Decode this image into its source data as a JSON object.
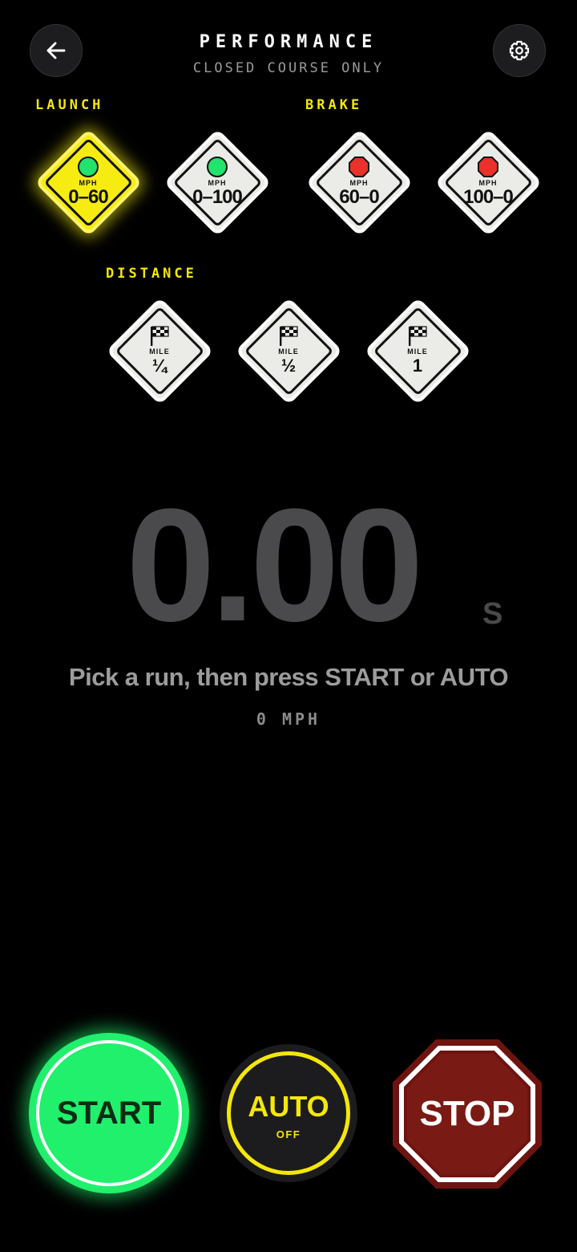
{
  "header": {
    "title": "PERFORMANCE",
    "subtitle": "CLOSED COURSE ONLY"
  },
  "sections": {
    "launch": "LAUNCH",
    "brake": "BRAKE",
    "distance": "DISTANCE"
  },
  "runs": [
    {
      "unit": "MPH",
      "value": "0–60",
      "kind": "launch",
      "selected": true
    },
    {
      "unit": "MPH",
      "value": "0–100",
      "kind": "launch",
      "selected": false
    },
    {
      "unit": "MPH",
      "value": "60–0",
      "kind": "brake",
      "selected": false
    },
    {
      "unit": "MPH",
      "value": "100–0",
      "kind": "brake",
      "selected": false
    },
    {
      "unit": "MILE",
      "value": "¼",
      "kind": "distance",
      "selected": false
    },
    {
      "unit": "MILE",
      "value": "½",
      "kind": "distance",
      "selected": false
    },
    {
      "unit": "MILE",
      "value": "1",
      "kind": "distance",
      "selected": false
    }
  ],
  "timer": {
    "value": "0.00",
    "unit": "S"
  },
  "hint": "Pick a run, then press START or AUTO",
  "speed": "0 MPH",
  "controls": {
    "start": "START",
    "auto": "AUTO",
    "auto_status": "OFF",
    "stop": "STOP"
  },
  "colors": {
    "accent_yellow": "#f4e70a",
    "start_green": "#21f06d",
    "stop_red": "#7a1a14"
  },
  "icons": {
    "back": "arrow-left-icon",
    "settings": "gear-icon",
    "launch": "green-light-icon",
    "brake": "stop-sign-icon",
    "distance": "checkered-flag-icon"
  }
}
